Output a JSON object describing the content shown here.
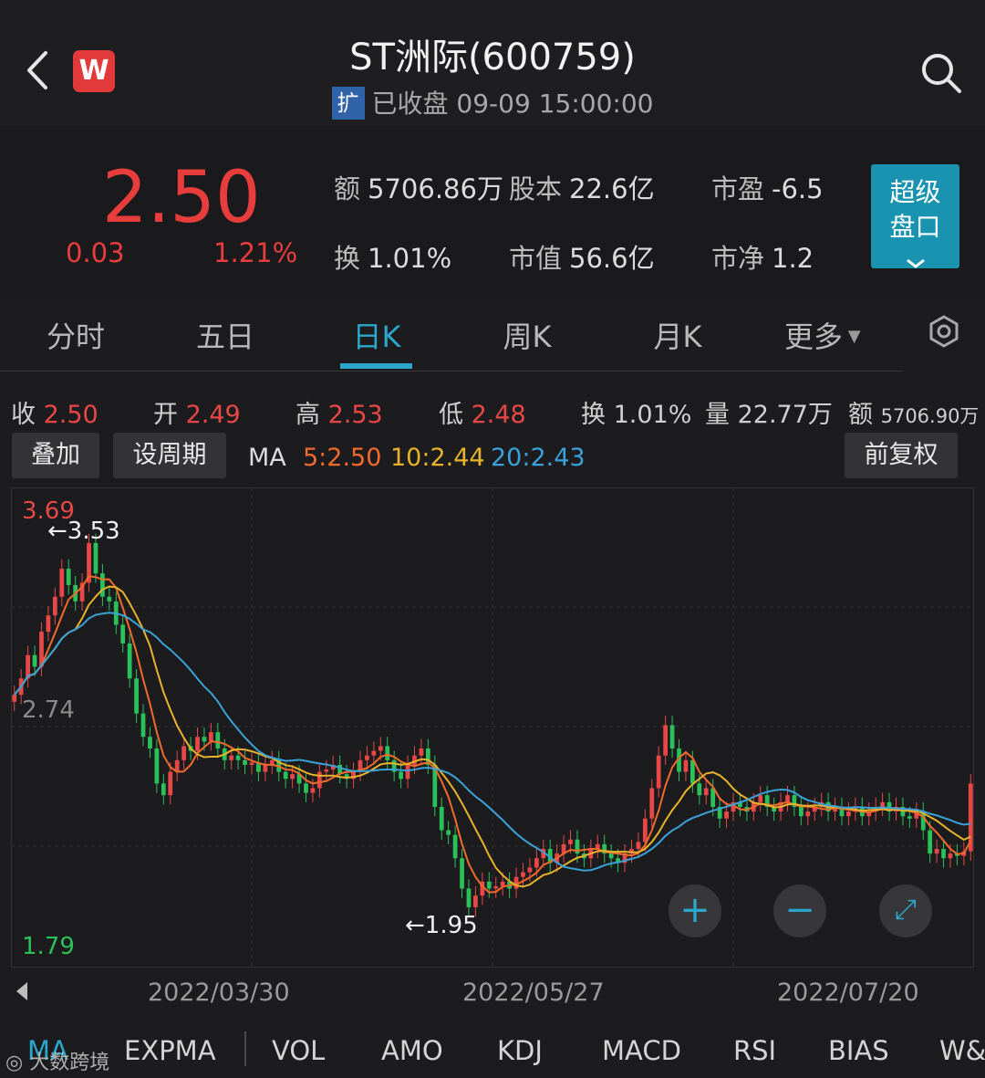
{
  "header": {
    "title": "ST洲际(600759)",
    "ext_badge": "扩",
    "status": "已收盘 09-09 15:00:00",
    "logo_letter": "W"
  },
  "quote": {
    "price": "2.50",
    "change": "0.03",
    "change_pct": "1.21%",
    "stats": [
      {
        "label": "额",
        "value": "5706.86万"
      },
      {
        "label": "股本",
        "value": "22.6亿"
      },
      {
        "label": "市盈",
        "value": "-6.5"
      },
      {
        "label": "换",
        "value": "1.01%"
      },
      {
        "label": "市值",
        "value": "56.6亿"
      },
      {
        "label": "市净",
        "value": "1.2"
      }
    ],
    "super_button": {
      "line1": "超级",
      "line2": "盘口",
      "chevron": "chevron-down-icon"
    }
  },
  "tabs": [
    {
      "label": "分时"
    },
    {
      "label": "五日"
    },
    {
      "label": "日K",
      "active": true
    },
    {
      "label": "周K"
    },
    {
      "label": "月K"
    },
    {
      "label": "更多"
    }
  ],
  "ohlc": [
    {
      "label": "收",
      "value": "2.50"
    },
    {
      "label": "开",
      "value": "2.49"
    },
    {
      "label": "高",
      "value": "2.53"
    },
    {
      "label": "低",
      "value": "2.48"
    },
    {
      "label": "换",
      "value": "1.01%"
    },
    {
      "label": "量",
      "value": "22.77万"
    },
    {
      "label": "额",
      "value": "5706.90万"
    }
  ],
  "controls": {
    "overlay": "叠加",
    "set_period": "设周期",
    "ma_title": "MA",
    "ma5": "5:2.50",
    "ma10": "10:2.44",
    "ma20": "20:2.43",
    "adjust": "前复权"
  },
  "colors": {
    "up": "#e84747",
    "down": "#2bc15a",
    "ma5": "#f06a2b",
    "ma10": "#e8b22c",
    "ma20": "#3aa2d8",
    "accent": "#2ba7cc"
  },
  "chart_data": {
    "type": "candlestick",
    "y_top_label": "3.69",
    "y_mid_label": "2.74",
    "y_bottom_label": "1.79",
    "ylim": [
      1.79,
      3.69
    ],
    "high_marker": "←3.53",
    "low_marker": "←1.95",
    "dates": [
      "2022/03/30",
      "2022/05/27",
      "2022/07/20"
    ],
    "close": [
      2.88,
      2.95,
      3.05,
      3.0,
      3.15,
      3.22,
      3.3,
      3.42,
      3.35,
      3.28,
      3.36,
      3.53,
      3.4,
      3.3,
      3.28,
      3.18,
      3.1,
      2.95,
      2.8,
      2.7,
      2.65,
      2.5,
      2.45,
      2.55,
      2.6,
      2.66,
      2.64,
      2.7,
      2.68,
      2.72,
      2.65,
      2.6,
      2.62,
      2.6,
      2.58,
      2.59,
      2.55,
      2.58,
      2.6,
      2.55,
      2.52,
      2.54,
      2.5,
      2.46,
      2.48,
      2.55,
      2.56,
      2.58,
      2.54,
      2.52,
      2.55,
      2.6,
      2.62,
      2.64,
      2.66,
      2.6,
      2.55,
      2.52,
      2.58,
      2.62,
      2.65,
      2.58,
      2.4,
      2.3,
      2.28,
      2.18,
      2.05,
      1.97,
      2.02,
      2.08,
      2.05,
      2.06,
      2.08,
      2.05,
      2.1,
      2.12,
      2.14,
      2.18,
      2.22,
      2.16,
      2.2,
      2.24,
      2.26,
      2.2,
      2.18,
      2.22,
      2.24,
      2.2,
      2.18,
      2.16,
      2.2,
      2.22,
      2.25,
      2.35,
      2.48,
      2.62,
      2.75,
      2.65,
      2.55,
      2.6,
      2.5,
      2.45,
      2.48,
      2.4,
      2.35,
      2.38,
      2.42,
      2.4,
      2.38,
      2.42,
      2.45,
      2.4,
      2.38,
      2.42,
      2.45,
      2.4,
      2.36,
      2.38,
      2.4,
      2.42,
      2.38,
      2.4,
      2.36,
      2.38,
      2.4,
      2.36,
      2.38,
      2.4,
      2.42,
      2.38,
      2.4,
      2.36,
      2.35,
      2.38,
      2.3,
      2.2,
      2.22,
      2.18,
      2.2,
      2.19,
      2.21,
      2.5
    ]
  },
  "indicators": [
    "MA",
    "EXPMA",
    "VOL",
    "AMO",
    "KDJ",
    "MACD",
    "RSI",
    "BIAS",
    "W&"
  ],
  "watermark": "大数跨境"
}
